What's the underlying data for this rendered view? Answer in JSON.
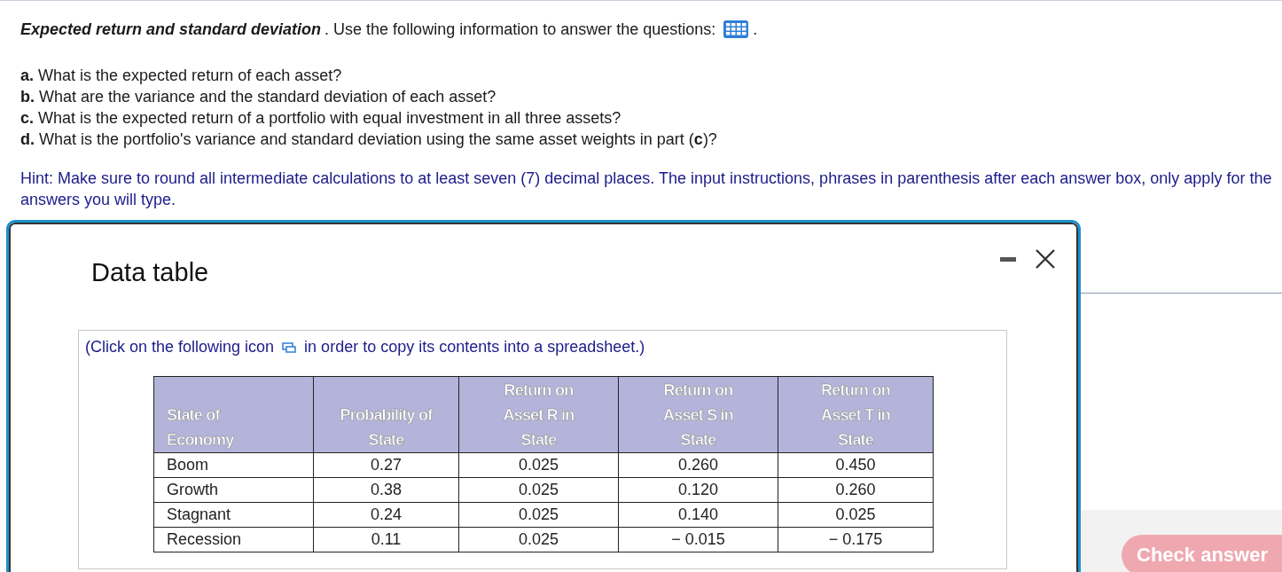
{
  "question": {
    "title": "Expected return and standard deviation",
    "title_end": ".",
    "intro": "Use the following information to answer the questions:",
    "intro_end": ".",
    "parts": [
      {
        "letter": "a.",
        "text": "What is the expected return of each asset?"
      },
      {
        "letter": "b.",
        "text": "What are the variance and the standard deviation of each asset?"
      },
      {
        "letter": "c.",
        "text": "What is the expected return of a portfolio with equal investment in all three assets?"
      },
      {
        "letter": "d.",
        "text": "What is the portfolio's variance and standard deviation using the same asset weights in part (**c**)?"
      }
    ],
    "hint": "Hint: Make sure to round all intermediate calculations to at least seven (7) decimal places. The input instructions, phrases in parenthesis after each answer box, only apply for the answers you will type."
  },
  "check_button": "Check answer",
  "dialog": {
    "title": "Data table",
    "copy_note_before": "(Click on the following icon",
    "copy_note_after": "in order to copy its contents into a spreadsheet.)",
    "table": {
      "columns": [
        "State of Economy",
        "Probability of State",
        "Return on Asset R in State",
        "Return on Asset S in State",
        "Return on Asset T in State"
      ],
      "rows": [
        [
          "Boom",
          "0.27",
          "0.025",
          "0.260",
          "0.450"
        ],
        [
          "Growth",
          "0.38",
          "0.025",
          "0.120",
          "0.260"
        ],
        [
          "Stagnant",
          "0.24",
          "0.025",
          "0.140",
          "0.025"
        ],
        [
          "Recession",
          "0.11",
          "0.025",
          "− 0.015",
          "− 0.175"
        ]
      ]
    }
  }
}
